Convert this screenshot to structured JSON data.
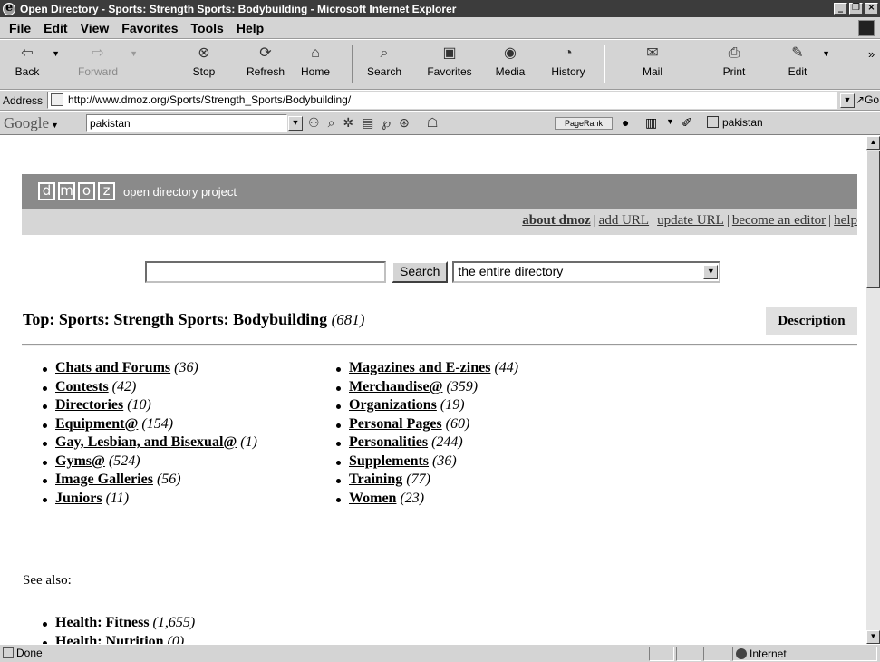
{
  "window": {
    "title": "Open Directory - Sports: Strength Sports: Bodybuilding - Microsoft Internet Explorer",
    "min": "_",
    "max": "❐",
    "close": "×"
  },
  "menu": [
    "File",
    "Edit",
    "View",
    "Favorites",
    "Tools",
    "Help"
  ],
  "toolbar": {
    "back": "Back",
    "forward": "Forward",
    "stop": "Stop",
    "refresh": "Refresh",
    "home": "Home",
    "search": "Search",
    "favorites": "Favorites",
    "media": "Media",
    "history": "History",
    "mail": "Mail",
    "print": "Print",
    "edit": "Edit",
    "more": "»"
  },
  "address": {
    "label": "Address",
    "url": "http://www.dmoz.org/Sports/Strength_Sports/Bodybuilding/",
    "go": "Go"
  },
  "google": {
    "logo": "Google",
    "query": "pakistan",
    "pagerank": "PageRank",
    "term_button": "pakistan"
  },
  "page": {
    "logo_letters": [
      "d",
      "m",
      "o",
      "z"
    ],
    "logo_text": "open directory project",
    "nav": {
      "about": "about dmoz",
      "add": "add URL",
      "update": "update URL",
      "editor": "become an editor",
      "help": "help"
    },
    "search": {
      "value": "",
      "button": "Search",
      "scope": "the entire directory"
    },
    "breadcrumb": {
      "top": "Top",
      "sports": "Sports",
      "strength": "Strength Sports",
      "current": "Bodybuilding",
      "count": "(681)",
      "sep": ":"
    },
    "description_button": "Description",
    "categories_left": [
      {
        "name": "Chats and Forums",
        "count": "(36)"
      },
      {
        "name": "Contests",
        "count": "(42)"
      },
      {
        "name": "Directories",
        "count": "(10)"
      },
      {
        "name": "Equipment@",
        "count": "(154)"
      },
      {
        "name": "Gay, Lesbian, and Bisexual@",
        "count": "(1)"
      },
      {
        "name": "Gyms@",
        "count": "(524)"
      },
      {
        "name": "Image Galleries",
        "count": "(56)"
      },
      {
        "name": "Juniors",
        "count": "(11)"
      }
    ],
    "categories_right": [
      {
        "name": "Magazines and E-zines",
        "count": "(44)"
      },
      {
        "name": "Merchandise@",
        "count": "(359)"
      },
      {
        "name": "Organizations",
        "count": "(19)"
      },
      {
        "name": "Personal Pages",
        "count": "(60)"
      },
      {
        "name": "Personalities",
        "count": "(244)"
      },
      {
        "name": "Supplements",
        "count": "(36)"
      },
      {
        "name": "Training",
        "count": "(77)"
      },
      {
        "name": "Women",
        "count": "(23)"
      }
    ],
    "see_also_label": "See also:",
    "see_also": [
      {
        "name": "Health: Fitness",
        "count": "(1,655)"
      },
      {
        "name": "Health: Nutrition",
        "count": "(0)"
      }
    ]
  },
  "status": {
    "text": "Done",
    "zone": "Internet"
  },
  "scrollbar": {
    "up": "▲",
    "down": "▼"
  }
}
